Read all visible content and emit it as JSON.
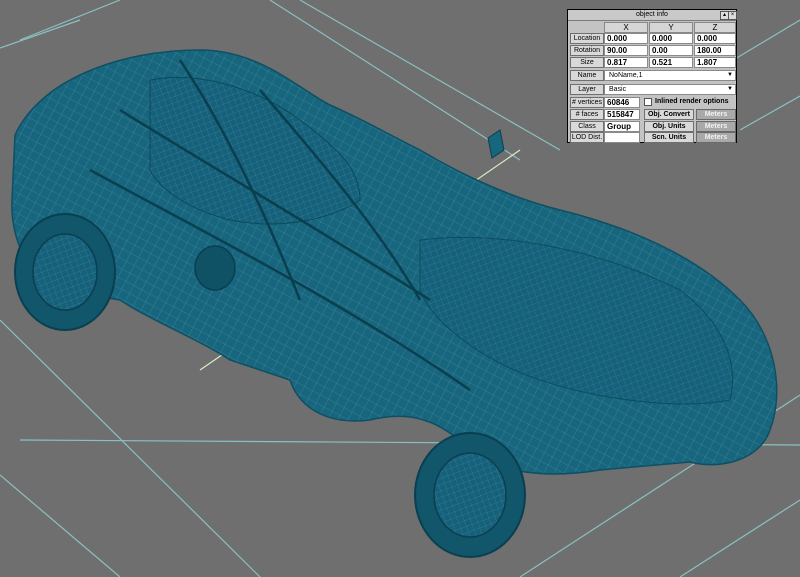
{
  "panel": {
    "title": "object info",
    "columns": [
      "X",
      "Y",
      "Z"
    ],
    "rows": [
      {
        "label": "Location",
        "values": [
          "0.000",
          "0.000",
          "0.000"
        ]
      },
      {
        "label": "Rotation",
        "values": [
          "90.00",
          "0.00",
          "180.00"
        ]
      },
      {
        "label": "Size",
        "values": [
          "0.817",
          "0.521",
          "1.807"
        ]
      }
    ],
    "name": {
      "label": "Name",
      "value": "NoName,1"
    },
    "layer": {
      "label": "Layer",
      "value": "Basic"
    },
    "vertices": {
      "label": "# vertices",
      "value": "60846"
    },
    "inlined_render_options": "Inlined render options",
    "faces": {
      "label": "# faces",
      "value": "515847"
    },
    "class": {
      "label": "Class",
      "value": "Group"
    },
    "lod": {
      "label": "LOD Dist.",
      "value": ""
    },
    "obj_convert": {
      "label": "Obj. Convert",
      "unit": "Meters"
    },
    "obj_units": {
      "label": "Obj. Units",
      "unit": "Meters"
    },
    "scn_units": {
      "label": "Scn. Units",
      "unit": "Meters"
    }
  },
  "colors": {
    "background": "#6f6f6f",
    "wireframe": "#17667e",
    "grid": "#8fcfd0",
    "axis": "#d7f0c8"
  }
}
